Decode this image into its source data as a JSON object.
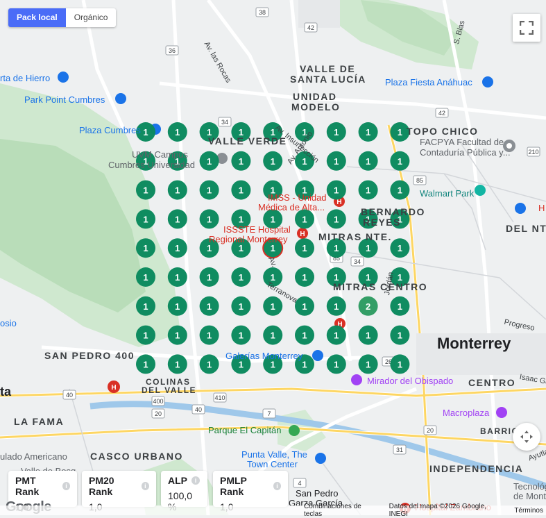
{
  "toggle": {
    "pack_local": "Pack local",
    "organico": "Orgánico"
  },
  "areas": {
    "valle_santa_lucia_1": "VALLE DE",
    "valle_santa_lucia_2": "SANTA LUCÍA",
    "unidad_modelo_1": "UNIDAD",
    "unidad_modelo_2": "MODELO",
    "valle_verde": "VALLE VERDE",
    "topo_chico": "TOPO CHICO",
    "bernardo_reyes_1": "BERNARDO",
    "bernardo_reyes_2": "REYES",
    "del_norte": "DEL NTE.",
    "mitras_nte": "MITRAS NTE.",
    "mitras_centro": "MITRAS CENTRO",
    "san_pedro_400": "SAN PEDRO 400",
    "colinas_1": "COLINAS",
    "colinas_2": "DEL VALLE",
    "centro": "CENTRO",
    "la_fama": "LA FAMA",
    "casco_urbano": "CASCO URBANO",
    "barrio": "BARRIO",
    "independencia": "INDEPENDENCIA"
  },
  "city": "Monterrey",
  "places": {
    "puerta_hierro": "rta de Hierro",
    "park_point": "Park Point Cumbres",
    "plaza_cumbres": "Plaza Cumbres",
    "uvm_1": "UVM Campus",
    "uvm_2": "Cumbres Universidad",
    "plaza_fiesta": "Plaza Fiesta Anáhuac",
    "facpya_1": "FACPYA Facultad de",
    "facpya_2": "Contaduría Pública y...",
    "walmart": "Walmart Park",
    "imss_1": "IMSS - Unidad",
    "imss_2": "Médica de Alta...",
    "issste_1": "ISSSTE Hospital",
    "issste_2": "Regional Monterrey",
    "galerias": "Galerías Monterrey",
    "mirador": "Mirador del Obispado",
    "macroplaza": "Macroplaza",
    "parque_capitan": "Parque El Capitán",
    "punta_valle_1": "Punta Valle, The",
    "punta_valle_2": "Town Center",
    "hospital_zambrano": "Hospital Zambrano",
    "tecnologico_1": "Tecnológ",
    "tecnologico_2": "de Monte",
    "oso": "osio",
    "ta": "ta",
    "americano": "ulado Americano",
    "valle_bosque": "Valle de Bosq",
    "san_pedro_garza_1": "San Pedro",
    "san_pedro_garza_2": "Garza García",
    "h_edge": "H"
  },
  "streets": {
    "av_rocas": "Av. las Rocas",
    "s_blas": "S. Blas",
    "av_insurreccion": "Av. Insurrección",
    "av_antonio": "Av. Antonio",
    "av_lincoln": "Av.",
    "terranova": "Terranova",
    "jordan": "Jordán",
    "progreso": "Progreso",
    "isaac": "Isaac Ga",
    "ayutla": "Ayutla",
    "pontiac": "Pon"
  },
  "road_numbers": [
    "38",
    "42",
    "36",
    "34",
    "42",
    "210",
    "85",
    "34",
    "85",
    "26",
    "40",
    "400",
    "410",
    "40",
    "20",
    "7",
    "20",
    "31",
    "4"
  ],
  "grid": {
    "rows": [
      [
        1,
        1,
        1,
        1,
        1,
        1,
        1,
        1,
        1
      ],
      [
        1,
        1,
        1,
        1,
        1,
        1,
        1,
        1,
        1
      ],
      [
        1,
        1,
        1,
        1,
        1,
        1,
        1,
        1,
        1
      ],
      [
        1,
        1,
        1,
        1,
        1,
        1,
        1,
        1,
        1
      ],
      [
        1,
        1,
        1,
        1,
        1,
        1,
        1,
        1,
        1
      ],
      [
        1,
        1,
        1,
        1,
        1,
        1,
        1,
        1,
        1
      ],
      [
        1,
        1,
        1,
        1,
        1,
        1,
        1,
        2,
        1
      ],
      [
        1,
        1,
        1,
        1,
        1,
        1,
        1,
        1,
        1
      ],
      [
        1,
        1,
        1,
        1,
        1,
        1,
        1,
        1,
        1
      ]
    ],
    "center": [
      4,
      4
    ],
    "colors": {
      "top": "#0b8a5e",
      "second": "#2f9c63",
      "center_ring": "#d93025"
    }
  },
  "metrics": [
    {
      "name": "PMT Rank",
      "value": "1,0"
    },
    {
      "name": "PM20 Rank",
      "value": "1,0"
    },
    {
      "name": "ALP",
      "value": "100,0 %"
    },
    {
      "name": "PMLP Rank",
      "value": "1,0"
    }
  ],
  "footer": {
    "google": "Google",
    "shortcuts": "Combinaciones de teclas",
    "map_data": "Datos del mapa ©2026 Google, INEGI",
    "terms": "Términos"
  },
  "icons": [
    "fullscreen-icon",
    "pan-icon",
    "info-icon",
    "hospital-icon",
    "shopping-icon",
    "park-icon",
    "landmark-icon"
  ]
}
